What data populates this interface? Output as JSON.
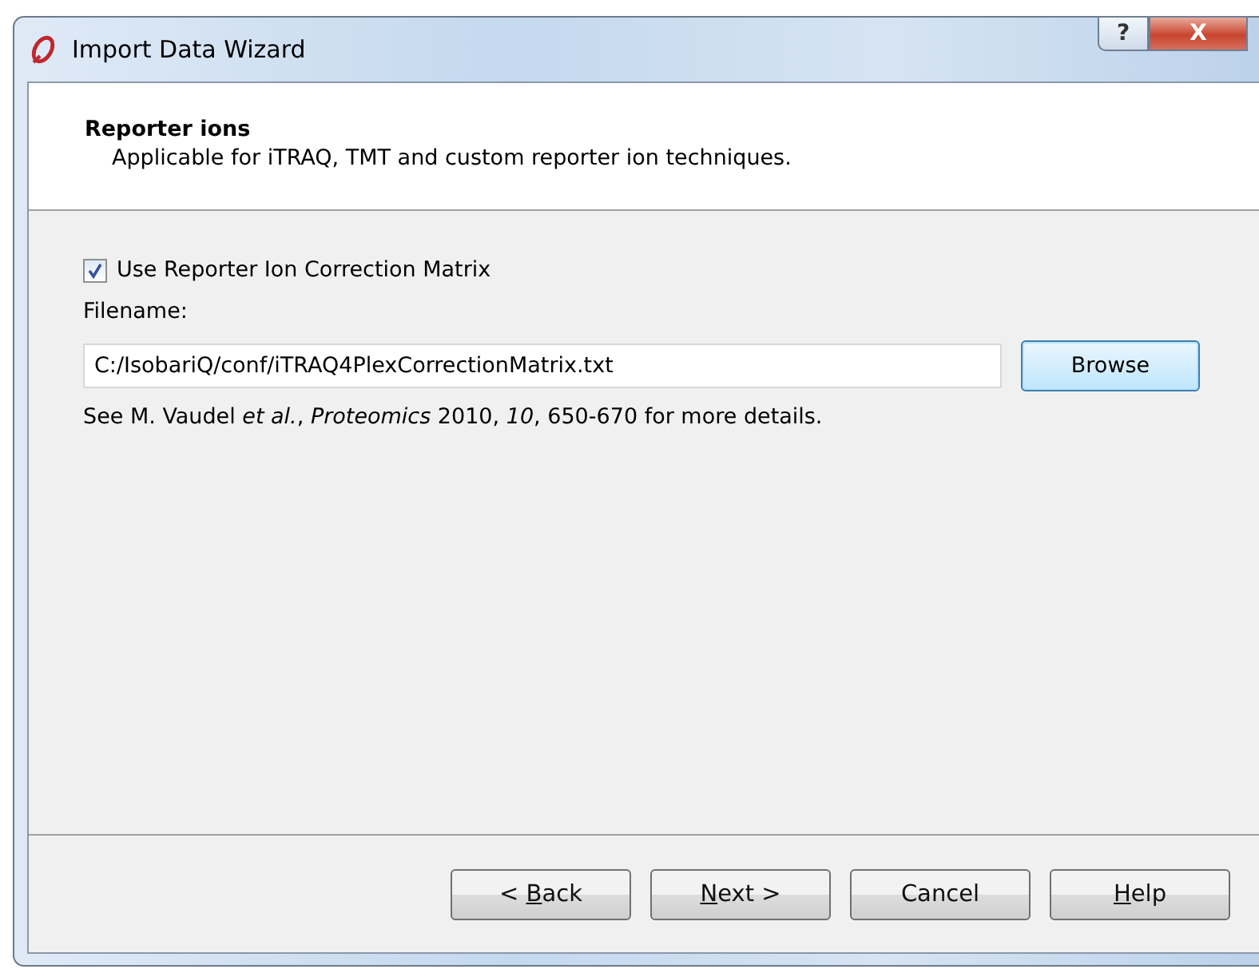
{
  "window": {
    "title": "Import Data Wizard",
    "help_button": "?",
    "close_button": "X"
  },
  "header": {
    "title": "Reporter ions",
    "subtitle": "Applicable for iTRAQ, TMT and custom reporter ion techniques."
  },
  "correction": {
    "label": "Use Reporter Ion Correction Matrix",
    "checked": true
  },
  "filename": {
    "label": "Filename:",
    "value": "C:/IsobariQ/conf/iTRAQ4PlexCorrectionMatrix.txt",
    "browse": "Browse"
  },
  "reference": "See M. Vaudel *et al.*, *Proteomics* 2010,  *10*, 650-670 for more details.",
  "buttons": [
    {
      "before": "< ",
      "underlined": "B",
      "after": "ack",
      "focused": false
    },
    {
      "underlined": "N",
      "after": "ext >",
      "focused": false
    },
    {
      "before": "Cancel",
      "focused": false
    },
    {
      "underlined": "H",
      "after": "elp",
      "focused": false
    }
  ]
}
